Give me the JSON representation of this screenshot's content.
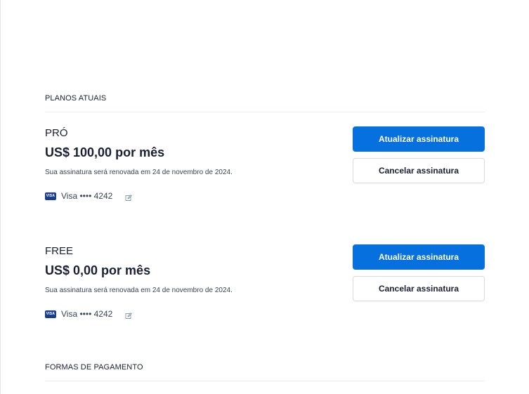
{
  "sections": {
    "current_plans_title": "PLANOS ATUAIS",
    "payment_methods_title": "FORMAS DE PAGAMENTO"
  },
  "plans": [
    {
      "name": "PRÓ",
      "price": "US$ 100,00 por mês",
      "renewal_text": "Sua assinatura será renovada em 24 de novembro de 2024.",
      "card_brand": "VISA",
      "card_text": "Visa •••• 4242",
      "update_label": "Atualizar assinatura",
      "cancel_label": "Cancelar assinatura"
    },
    {
      "name": "FREE",
      "price": "US$ 0,00 por mês",
      "renewal_text": "Sua assinatura será renovada em 24 de novembro de 2024.",
      "card_brand": "VISA",
      "card_text": "Visa •••• 4242",
      "update_label": "Atualizar assinatura",
      "cancel_label": "Cancelar assinatura"
    }
  ],
  "colors": {
    "primary": "#0570de",
    "text": "#1a1f36",
    "border": "#d7dbe0",
    "visa": "#1a3e8a"
  },
  "icons": {
    "card": "visa-card-icon",
    "edit": "edit-icon"
  }
}
